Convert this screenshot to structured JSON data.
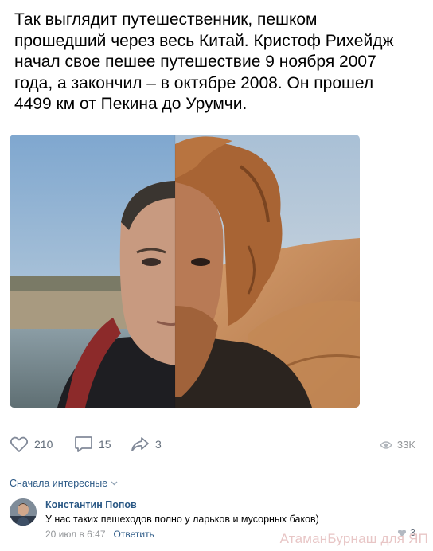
{
  "post": {
    "text": "Так выглядит путешественник, пешком прошедший через весь Китай. Кристоф Рихейдж начал свое пешее путешествие 9 ноября 2007 года, а закончил – в октябре 2008. Он прошел 4499 км от Пекина до Урумчи."
  },
  "actions": {
    "likes": "210",
    "comments": "15",
    "shares": "3",
    "views": "33K"
  },
  "comments": {
    "sort_label": "Сначала интересные",
    "items": [
      {
        "author": "Константин Попов",
        "text": "У нас таких пешеходов полно у ларьков и мусорных баков)",
        "time": "20 июл в 6:47",
        "reply_label": "Ответить",
        "likes": "3"
      }
    ]
  },
  "watermark": "АтаманБурнаш для ЯП",
  "colors": {
    "link": "#2a5885",
    "icon": "#828a99",
    "meta": "#939699"
  }
}
